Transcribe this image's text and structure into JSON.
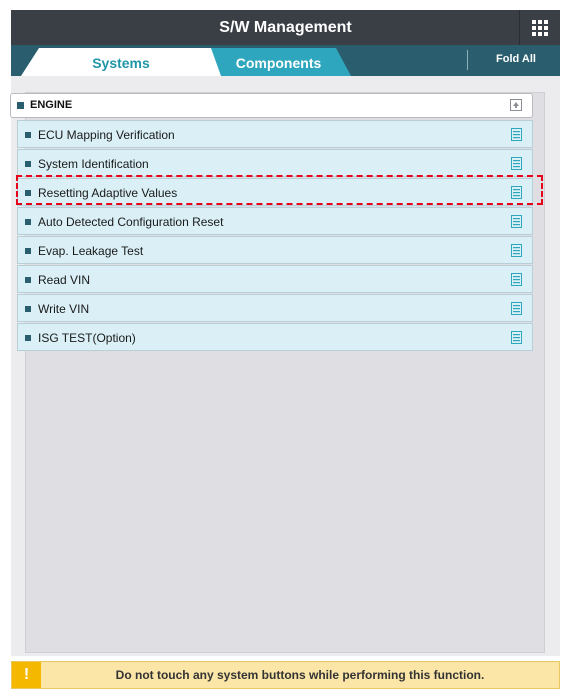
{
  "header": {
    "title": "S/W Management",
    "menu_icon": "grid-icon"
  },
  "tabs": [
    {
      "label": "Systems",
      "active": true
    },
    {
      "label": "Components",
      "active": false
    }
  ],
  "fold_all_label": "Fold All",
  "section": {
    "label": "ENGINE",
    "collapse_icon": "collapse-up-icon"
  },
  "items": [
    {
      "label": "ECU Mapping Verification"
    },
    {
      "label": "System Identification"
    },
    {
      "label": "Resetting Adaptive Values",
      "highlighted": true
    },
    {
      "label": "Auto Detected Configuration Reset"
    },
    {
      "label": "Evap. Leakage Test"
    },
    {
      "label": "Read VIN"
    },
    {
      "label": "Write VIN"
    },
    {
      "label": "ISG TEST(Option)"
    }
  ],
  "notice": {
    "icon": "warning-icon",
    "symbol": "!",
    "text": "Do not touch any system buttons while performing this function."
  },
  "colors": {
    "header": "#3a3f46",
    "tabbar": "#2a5e6e",
    "active_tab_text": "#2196a8",
    "inactive_tab": "#2ea6bd",
    "row_bg": "#daf0f6",
    "highlight": "#e8001a",
    "notice_bg": "#fbe6a8",
    "warning": "#f5b800"
  }
}
